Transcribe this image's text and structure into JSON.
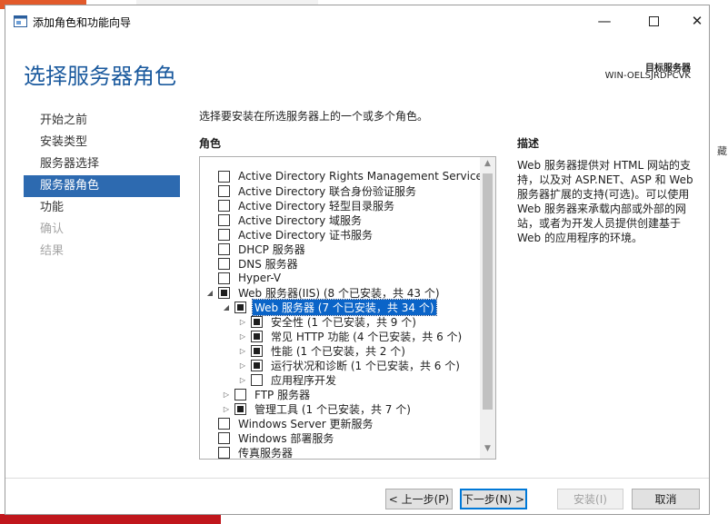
{
  "window": {
    "title": "添加角色和功能向导",
    "page_title": "选择服务器角色",
    "dest_label": "目标服务器",
    "dest_server": "WIN-OELSJRDPCVK"
  },
  "steps": [
    {
      "label": "开始之前",
      "state": "normal"
    },
    {
      "label": "安装类型",
      "state": "normal"
    },
    {
      "label": "服务器选择",
      "state": "normal"
    },
    {
      "label": "服务器角色",
      "state": "active"
    },
    {
      "label": "功能",
      "state": "normal"
    },
    {
      "label": "确认",
      "state": "disabled"
    },
    {
      "label": "结果",
      "state": "disabled"
    }
  ],
  "main": {
    "instruction": "选择要安装在所选服务器上的一个或多个角色。",
    "roles_heading": "角色",
    "roles": [
      {
        "label": "Active Directory Rights Management Services",
        "level": 0,
        "expander": "",
        "check": "none",
        "selected": false
      },
      {
        "label": "Active Directory 联合身份验证服务",
        "level": 0,
        "expander": "",
        "check": "none",
        "selected": false
      },
      {
        "label": "Active Directory 轻型目录服务",
        "level": 0,
        "expander": "",
        "check": "none",
        "selected": false
      },
      {
        "label": "Active Directory 域服务",
        "level": 0,
        "expander": "",
        "check": "none",
        "selected": false
      },
      {
        "label": "Active Directory 证书服务",
        "level": 0,
        "expander": "",
        "check": "none",
        "selected": false
      },
      {
        "label": "DHCP 服务器",
        "level": 0,
        "expander": "",
        "check": "none",
        "selected": false
      },
      {
        "label": "DNS 服务器",
        "level": 0,
        "expander": "",
        "check": "none",
        "selected": false
      },
      {
        "label": "Hyper-V",
        "level": 0,
        "expander": "",
        "check": "none",
        "selected": false
      },
      {
        "label": "Web 服务器(IIS) (8 个已安装，共 43 个)",
        "level": 0,
        "expander": "open",
        "check": "partial",
        "selected": false
      },
      {
        "label": "Web 服务器 (7 个已安装，共 34 个)",
        "level": 1,
        "expander": "open",
        "check": "partial",
        "selected": true
      },
      {
        "label": "安全性 (1 个已安装，共 9 个)",
        "level": 2,
        "expander": "closed",
        "check": "partial",
        "selected": false
      },
      {
        "label": "常见 HTTP 功能 (4 个已安装，共 6 个)",
        "level": 2,
        "expander": "closed",
        "check": "partial",
        "selected": false
      },
      {
        "label": "性能 (1 个已安装，共 2 个)",
        "level": 2,
        "expander": "closed",
        "check": "partial",
        "selected": false
      },
      {
        "label": "运行状况和诊断 (1 个已安装，共 6 个)",
        "level": 2,
        "expander": "closed",
        "check": "partial",
        "selected": false
      },
      {
        "label": "应用程序开发",
        "level": 2,
        "expander": "closed",
        "check": "none",
        "selected": false
      },
      {
        "label": "FTP 服务器",
        "level": 1,
        "expander": "closed",
        "check": "none",
        "selected": false
      },
      {
        "label": "管理工具 (1 个已安装，共 7 个)",
        "level": 1,
        "expander": "closed",
        "check": "partial",
        "selected": false
      },
      {
        "label": "Windows Server 更新服务",
        "level": 0,
        "expander": "",
        "check": "none",
        "selected": false
      },
      {
        "label": "Windows 部署服务",
        "level": 0,
        "expander": "",
        "check": "none",
        "selected": false
      },
      {
        "label": "传真服务器",
        "level": 0,
        "expander": "",
        "check": "none",
        "selected": false
      }
    ],
    "description_heading": "描述",
    "description": "Web 服务器提供对 HTML 网站的支持，以及对 ASP.NET、ASP 和 Web 服务器扩展的支持(可选)。可以使用 Web 服务器来承载内部或外部的网站，或者为开发人员提供创建基于 Web 的应用程序的环境。"
  },
  "buttons": {
    "prev": "< 上一步(P)",
    "next": "下一步(N) >",
    "install": "安装(I)",
    "cancel": "取消"
  },
  "background": {
    "right_edge_text": "藏"
  },
  "icons": {
    "app": "wizard-app-icon",
    "minimize": "minimize-icon",
    "maximize": "maximize-icon",
    "close": "close-icon"
  },
  "colors": {
    "accent": "#2d6ab0",
    "title_blue": "#1b5a9e",
    "selection": "#0a64c8"
  }
}
